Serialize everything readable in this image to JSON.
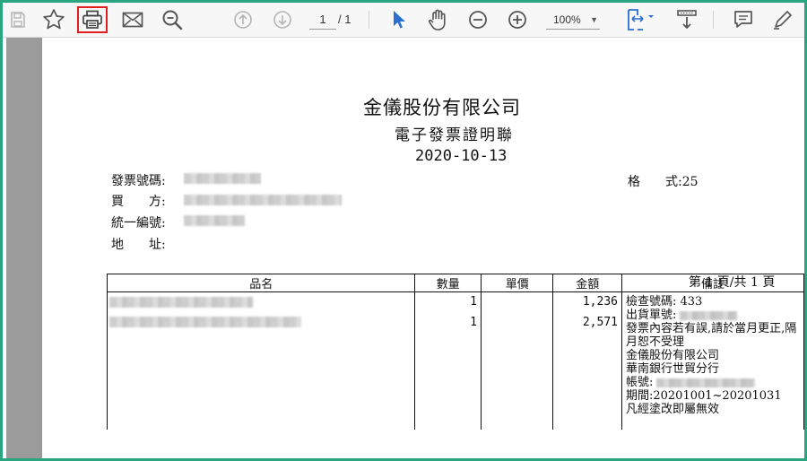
{
  "toolbar": {
    "page_current": "1",
    "page_total": "/ 1",
    "zoom": "100%"
  },
  "document": {
    "company": "金儀股份有限公司",
    "subtitle": "電子發票證明聯",
    "date": "2020-10-13",
    "labels": {
      "invoice_no": "發票號碼:",
      "buyer": "買　　方:",
      "tax_id": "統一編號:",
      "address": "地　　址:"
    },
    "format": "格　　式:25",
    "page_count": "第 1 頁/共 1 頁"
  },
  "table": {
    "headers": [
      "品名",
      "數量",
      "單價",
      "金額",
      "備註"
    ],
    "rows": [
      {
        "qty": "1",
        "amount": "1,236"
      },
      {
        "qty": "1",
        "amount": "2,571"
      }
    ],
    "notes": {
      "check_no": "檢查號碼: 433",
      "delivery_no": "出貨單號:",
      "line1": "發票內容若有誤,請於當月更正,隔月恕不受理",
      "company": "金儀股份有限公司",
      "bank": "華南銀行世貿分行",
      "account": "帳號:",
      "period": "期間:20201001~20201031",
      "void": "凡經塗改即屬無效"
    }
  },
  "colors": {
    "frame": "#2aa57f",
    "highlight": "#e02020",
    "accent_blue": "#2a6fd1",
    "gutter": "#9b9b9b"
  }
}
